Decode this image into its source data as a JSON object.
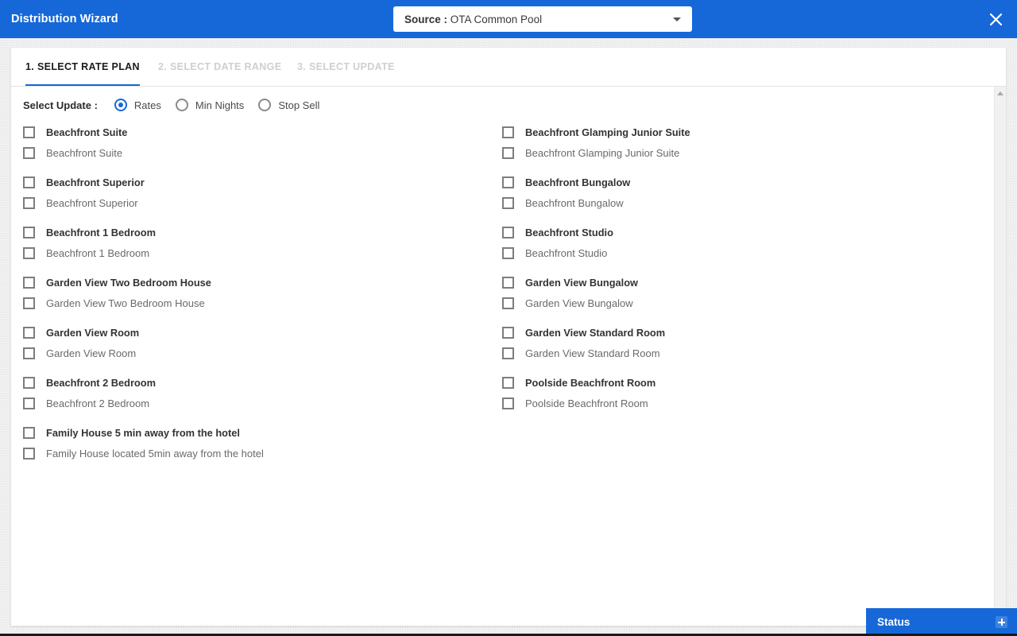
{
  "header": {
    "app_title": "Distribution Wizard",
    "source_label": "Source :",
    "source_value": "OTA Common Pool",
    "close_label": "✕"
  },
  "tabs": [
    {
      "label": "1. SELECT RATE PLAN",
      "active": true
    },
    {
      "label": "2. SELECT DATE RANGE",
      "active": false
    },
    {
      "label": "3. SELECT UPDATE",
      "active": false
    }
  ],
  "update_selector": {
    "label": "Select Update :",
    "options": [
      {
        "label": "Rates",
        "selected": true
      },
      {
        "label": "Min Nights",
        "selected": false
      },
      {
        "label": "Stop Sell",
        "selected": false
      }
    ]
  },
  "rate_plans": {
    "left_column": [
      {
        "room": "Beachfront Suite",
        "plan": "Beachfront Suite"
      },
      {
        "room": "Beachfront Superior",
        "plan": "Beachfront Superior"
      },
      {
        "room": "Beachfront 1 Bedroom",
        "plan": "Beachfront 1 Bedroom"
      },
      {
        "room": "Garden View Two Bedroom House",
        "plan": "Garden View Two Bedroom House"
      },
      {
        "room": "Garden View Room",
        "plan": "Garden View Room"
      },
      {
        "room": "Beachfront 2 Bedroom",
        "plan": "Beachfront 2 Bedroom"
      },
      {
        "room": "Family House 5 min away from the hotel",
        "plan": "Family House located 5min away from the hotel"
      }
    ],
    "right_column": [
      {
        "room": "Beachfront Glamping Junior Suite",
        "plan": "Beachfront Glamping Junior Suite"
      },
      {
        "room": "Beachfront Bungalow",
        "plan": "Beachfront Bungalow"
      },
      {
        "room": "Beachfront Studio",
        "plan": "Beachfront Studio"
      },
      {
        "room": "Garden View Bungalow",
        "plan": "Garden View Bungalow"
      },
      {
        "room": "Garden View Standard Room",
        "plan": "Garden View Standard Room"
      },
      {
        "room": "Poolside Beachfront Room",
        "plan": "Poolside Beachfront Room"
      }
    ]
  },
  "status_bar": {
    "title": "Status",
    "expand_icon": "plus-icon"
  },
  "colors": {
    "accent_blue": "#1668d8",
    "status_plus_bg": "#3c83e0",
    "page_background": "#ededed"
  }
}
